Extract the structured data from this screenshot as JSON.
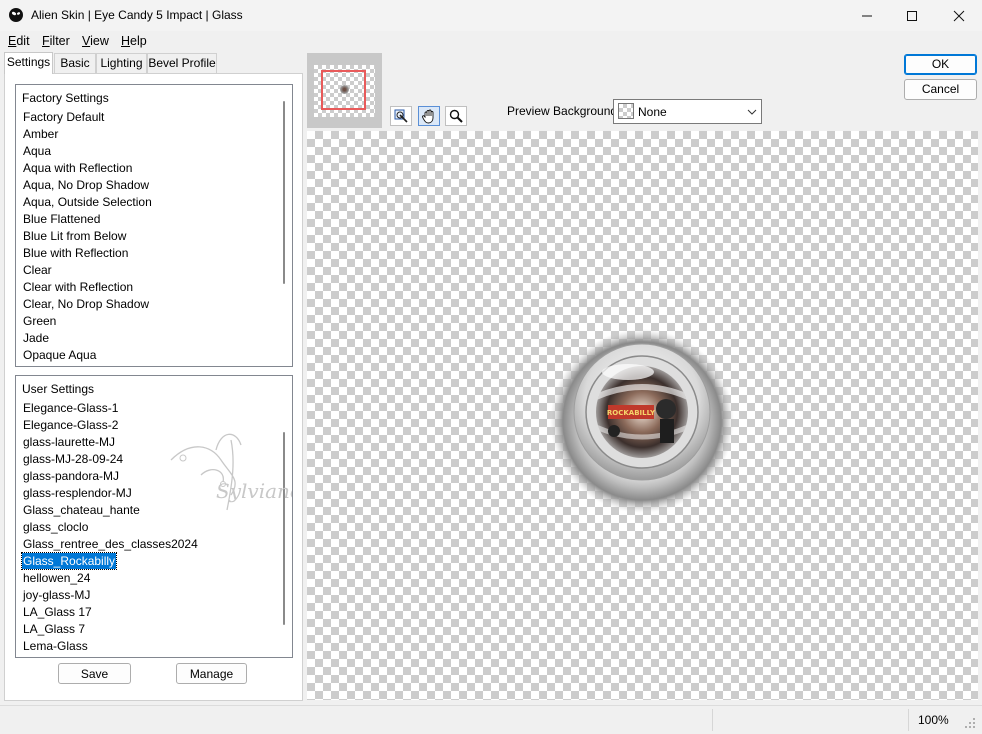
{
  "window": {
    "title": "Alien Skin | Eye Candy 5 Impact | Glass",
    "app_icon": "alien-skin-logo-icon",
    "controls": [
      "minimize-icon",
      "maximize-icon",
      "close-icon"
    ]
  },
  "menu": [
    {
      "label": "Edit",
      "ul": "E",
      "rest": "dit"
    },
    {
      "label": "Filter",
      "ul": "F",
      "rest": "ilter"
    },
    {
      "label": "View",
      "ul": "V",
      "rest": "iew"
    },
    {
      "label": "Help",
      "ul": "H",
      "rest": "elp"
    }
  ],
  "tabs": [
    {
      "label": "Settings",
      "active": true
    },
    {
      "label": "Basic",
      "active": false
    },
    {
      "label": "Lighting",
      "active": false
    },
    {
      "label": "Bevel Profile",
      "active": false
    }
  ],
  "factory_settings": {
    "header": "Factory Settings",
    "items": [
      "Factory Default",
      "Amber",
      "Aqua",
      "Aqua with Reflection",
      "Aqua, No Drop Shadow",
      "Aqua, Outside Selection",
      "Blue Flattened",
      "Blue Lit from Below",
      "Blue with Reflection",
      "Clear",
      "Clear with Reflection",
      "Clear, No Drop Shadow",
      "Green",
      "Jade",
      "Opaque Aqua"
    ]
  },
  "user_settings": {
    "header": "User Settings",
    "items": [
      "Elegance-Glass-1",
      "Elegance-Glass-2",
      "glass-laurette-MJ",
      "glass-MJ-28-09-24",
      "glass-pandora-MJ",
      "glass-resplendor-MJ",
      "Glass_chateau_hante",
      "glass_cloclo",
      "Glass_rentree_des_classes2024",
      "Glass_Rockabilly",
      "hellowen_24",
      "joy-glass-MJ",
      "LA_Glass 17",
      "LA_Glass 7",
      "Lema-Glass"
    ],
    "selected": "Glass_Rockabilly"
  },
  "buttons": {
    "save": "Save",
    "manage": "Manage",
    "ok": "OK",
    "cancel": "Cancel"
  },
  "toolbar": {
    "tools": [
      "navigator-icon",
      "hand-pan-icon",
      "zoom-magnifier-icon"
    ],
    "active_tool": "hand-pan-icon"
  },
  "preview_background": {
    "label": "Preview Background:",
    "value": "None",
    "swatch_icon": "checker-swatch-icon"
  },
  "preview": {
    "artwork": "glass-orb-rockabilly-preview",
    "artwork_text": "ROCKABILLY",
    "watermark_text": "Sylviane"
  },
  "status": {
    "zoom": "100%"
  },
  "colors": {
    "selection": "#0078d7",
    "default_button_border": "#0078d7",
    "thumb_rect": "#e85a5a"
  }
}
